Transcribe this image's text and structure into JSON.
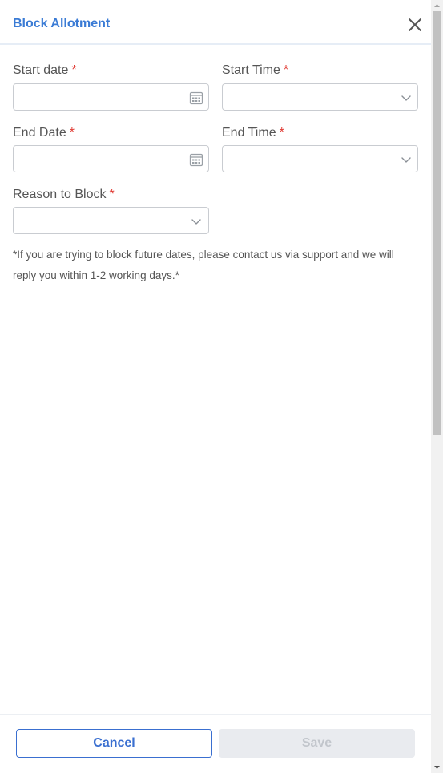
{
  "dialog": {
    "title": "Block Allotment",
    "close_icon": "close-icon"
  },
  "form": {
    "start_date": {
      "label": "Start date",
      "required": "*",
      "value": "",
      "icon": "calendar-icon"
    },
    "start_time": {
      "label": "Start Time",
      "required": "*",
      "value": "",
      "icon": "chevron-down-icon"
    },
    "end_date": {
      "label": "End Date",
      "required": "*",
      "value": "",
      "icon": "calendar-icon"
    },
    "end_time": {
      "label": "End Time",
      "required": "*",
      "value": "",
      "icon": "chevron-down-icon"
    },
    "reason": {
      "label": "Reason to Block",
      "required": "*",
      "value": "",
      "icon": "chevron-down-icon"
    }
  },
  "note": "*If you are trying to block future dates, please contact us via support and we will reply you within 1-2 working days.*",
  "footer": {
    "cancel_label": "Cancel",
    "save_label": "Save"
  },
  "colors": {
    "accent": "#3a7bd5",
    "required": "#e0362f",
    "disabled_bg": "#e9ebef"
  }
}
